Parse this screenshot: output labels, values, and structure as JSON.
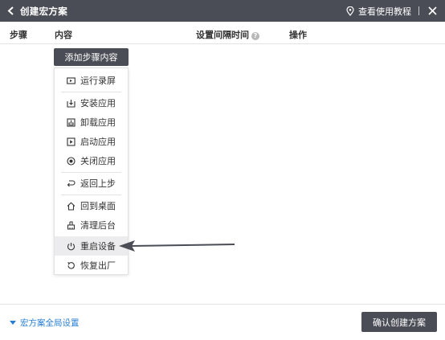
{
  "window": {
    "title": "创建宏方案",
    "tutorial_label": "查看使用教程",
    "separator": "|"
  },
  "columns": {
    "step": "步骤",
    "content": "内容",
    "interval": "设置间隔时间",
    "interval_help": "?",
    "action": "操作"
  },
  "add_step": {
    "label": "添加步骤内容"
  },
  "menu": {
    "items": [
      {
        "label": "运行录屏",
        "icon": "record-screen-icon"
      },
      {
        "label": "安装应用",
        "icon": "install-app-icon"
      },
      {
        "label": "卸载应用",
        "icon": "uninstall-app-icon"
      },
      {
        "label": "启动应用",
        "icon": "launch-app-icon"
      },
      {
        "label": "关闭应用",
        "icon": "close-app-icon"
      },
      {
        "label": "返回上步",
        "icon": "back-step-icon"
      },
      {
        "label": "回到桌面",
        "icon": "home-icon"
      },
      {
        "label": "清理后台",
        "icon": "clean-background-icon"
      },
      {
        "label": "重启设备",
        "icon": "power-icon",
        "active": true
      },
      {
        "label": "恢复出厂",
        "icon": "factory-reset-icon"
      }
    ]
  },
  "footer": {
    "global_settings": "宏方案全局设置",
    "confirm": "确认创建方案"
  },
  "colors": {
    "titlebar": "#4a4d55",
    "link": "#2a7fd4",
    "active_item": "#ececee"
  }
}
